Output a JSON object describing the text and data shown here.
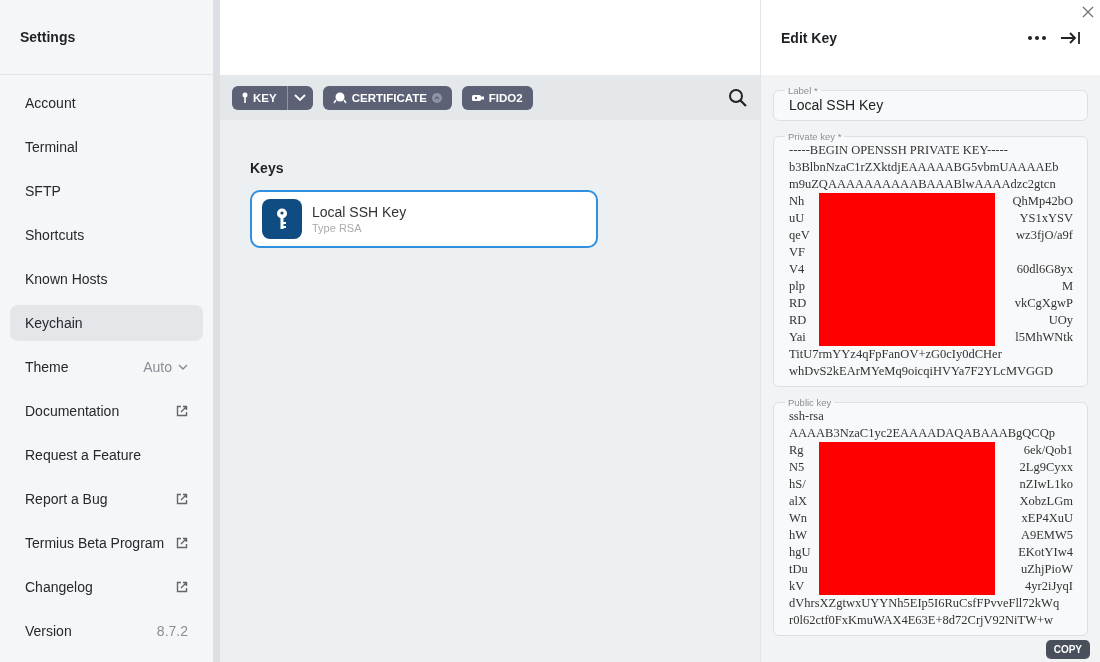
{
  "sidebar": {
    "title": "Settings",
    "items": [
      {
        "kind": "nav",
        "label": "Account",
        "selected": false
      },
      {
        "kind": "nav",
        "label": "Terminal",
        "selected": false
      },
      {
        "kind": "nav",
        "label": "SFTP",
        "selected": false
      },
      {
        "kind": "nav",
        "label": "Shortcuts",
        "selected": false
      },
      {
        "kind": "nav",
        "label": "Known Hosts",
        "selected": false
      },
      {
        "kind": "nav",
        "label": "Keychain",
        "selected": true
      },
      {
        "kind": "select",
        "label": "Theme",
        "value": "Auto"
      },
      {
        "kind": "link",
        "label": "Documentation",
        "external": true
      },
      {
        "kind": "link",
        "label": "Request a Feature",
        "external": false
      },
      {
        "kind": "link",
        "label": "Report a Bug",
        "external": true
      },
      {
        "kind": "link",
        "label": "Termius Beta Program",
        "external": true
      },
      {
        "kind": "link",
        "label": "Changelog",
        "external": true
      },
      {
        "kind": "info",
        "label": "Version",
        "value": "8.7.2"
      }
    ]
  },
  "toolbar": {
    "buttons": [
      {
        "kind": "split",
        "label": "KEY"
      },
      {
        "kind": "certificate",
        "label": "CERTIFICATE"
      },
      {
        "kind": "fido",
        "label": "FIDO2"
      }
    ]
  },
  "keys": {
    "heading": "Keys",
    "items": [
      {
        "name": "Local SSH Key",
        "type": "Type RSA",
        "selected": true
      }
    ]
  },
  "editor": {
    "title": "Edit Key",
    "label_field": {
      "label": "Label *",
      "value": "Local SSH Key"
    },
    "private_key": {
      "label": "Private key *",
      "lines": [
        {
          "text": "-----BEGIN OPENSSH PRIVATE KEY-----"
        },
        {
          "text": "b3BlbnNzaC1rZXktdjEAAAAABG5vbmUAAAAEb"
        },
        {
          "text": "m9uZQAAAAAAAAAABAAABlwAAAAdzc2gtcn"
        },
        {
          "start": "Nh",
          "end": "QhMp42bO"
        },
        {
          "start": "uU",
          "end": "YS1xYSV"
        },
        {
          "start": "qeV",
          "end": "wz3fjO/a9f"
        },
        {
          "start": "VF"
        },
        {
          "start": "V4",
          "end": "60dl6G8yx"
        },
        {
          "start": "plp",
          "end": "M"
        },
        {
          "start": "RD",
          "end": "vkCgXgwP"
        },
        {
          "start": "RD",
          "end": "UOy"
        },
        {
          "start": "Yai",
          "end": "l5MhWNtk"
        },
        {
          "text": "TitU7rmYYz4qFpFanOV+zG0cIy0dCHer"
        },
        {
          "text": "whDvS2kEArMYeMq9oicqiHVYa7F2YLcMVGGD"
        }
      ]
    },
    "public_key": {
      "label": "Public key",
      "lines": [
        {
          "text": "ssh-rsa"
        },
        {
          "text": "AAAAB3NzaC1yc2EAAAADAQABAAABgQCQp"
        },
        {
          "start": "Rg",
          "end": "6ek/Qob1"
        },
        {
          "start": "N5",
          "end": "2Lg9Cyxx"
        },
        {
          "start": "hS/",
          "end": "nZIwL1ko"
        },
        {
          "start": "alX",
          "end": "XobzLGm"
        },
        {
          "start": "Wn",
          "end": "xEP4XuU"
        },
        {
          "start": "hW",
          "end": "A9EMW5"
        },
        {
          "start": "hgU",
          "end": "EKotYIw4"
        },
        {
          "start": "tDu",
          "end": "uZhjPioW"
        },
        {
          "start": "kV",
          "end": "4yr2iJyqI"
        },
        {
          "text": "dVhrsXZgtwxUYYNh5EIp5I6RuCsfFPvveFll72kWq"
        },
        {
          "text": "r0l62ctf0FxKmuWAX4E63E+8d72CrjV92NiTW+w"
        }
      ]
    },
    "copy_button": "COPY"
  }
}
